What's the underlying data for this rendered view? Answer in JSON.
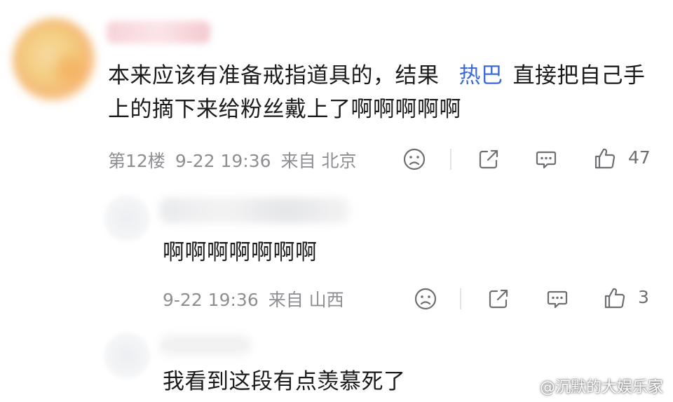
{
  "comments": [
    {
      "content_parts": [
        "本来应该有准备戒指道具的，结果",
        "热巴",
        "直接把自己手上的摘下来给粉丝戴上了啊啊啊啊啊"
      ],
      "floor": "第12楼",
      "time": "9-22 19:36",
      "location": "来自 北京",
      "likes": "47"
    },
    {
      "content": "啊啊啊啊啊啊啊",
      "time": "9-22 19:36",
      "location": "来自 山西",
      "likes": "3"
    },
    {
      "content": "我看到这段有点羡慕死了"
    }
  ],
  "watermark": "@沉默的大娱乐家",
  "colors": {
    "mention": "#3c6bd8",
    "meta": "#8e8e93"
  },
  "icons": [
    "dislike-icon",
    "share-icon",
    "comment-icon",
    "like-icon",
    "weibo-logo-icon"
  ]
}
